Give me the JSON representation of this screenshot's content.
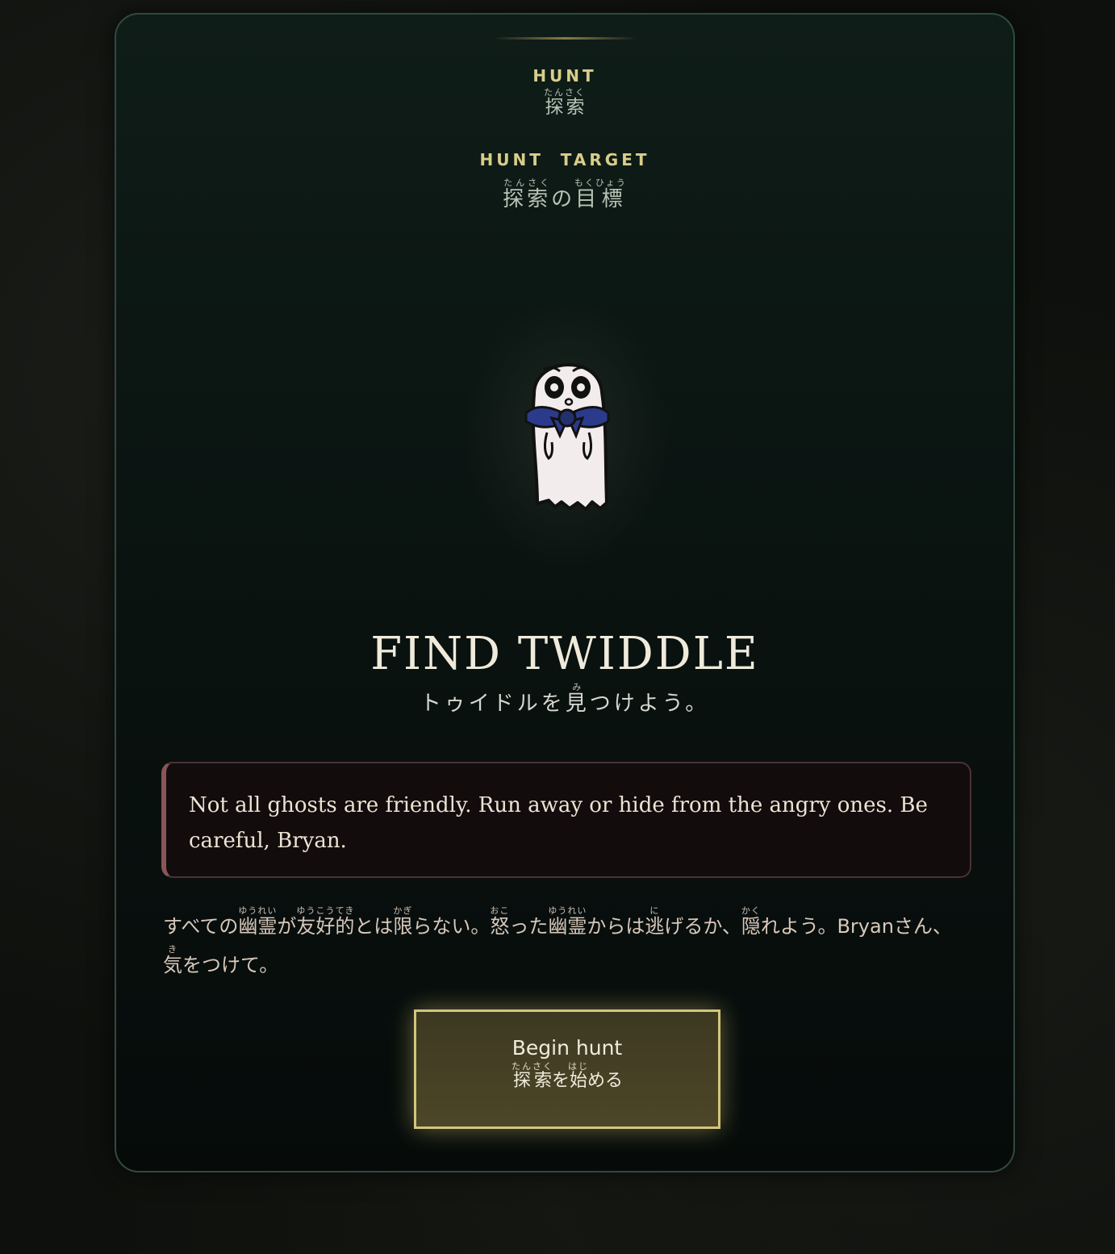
{
  "section": {
    "label_en": "HUNT",
    "label_ja_base": "探索",
    "label_ja_ruby": "たんさく"
  },
  "target": {
    "label_en": "HUNT TARGET",
    "ja_parts": [
      {
        "base": "探索",
        "ruby": "たんさく"
      },
      {
        "base": "の",
        "ruby": ""
      },
      {
        "base": "目標",
        "ruby": "もくひょう"
      }
    ]
  },
  "ghost": {
    "icon": "ghost-with-blue-bow-icon",
    "colors": {
      "body": "#f3ecec",
      "bow": "#2c3a8c",
      "outline": "#111111"
    }
  },
  "mission": {
    "title": "FIND TWIDDLE",
    "subtitle_pre": "トゥイドルを",
    "subtitle_kanji": "見",
    "subtitle_kanji_ruby": "み",
    "subtitle_post": "つけよう。"
  },
  "warning": {
    "text": "Not all ghosts are friendly. Run away or hide from the angry ones. Be careful, Bryan."
  },
  "warning_ja": {
    "s1": "すべての",
    "k1": "幽霊",
    "r1": "ゆうれい",
    "s2": "が",
    "k2": "友好的",
    "r2": "ゆうこうてき",
    "s3": "とは",
    "k3": "限",
    "r3": "かぎ",
    "s4": "らない。",
    "k4": "怒",
    "r4": "おこ",
    "s5": "った",
    "k5": "幽霊",
    "r5": "ゆうれい",
    "s6": "からは",
    "k6": "逃",
    "r6": "に",
    "s7": "げるか、",
    "k7": "隠",
    "r7": "かく",
    "s8": "れよう。Bryanさん、",
    "k8": "気",
    "r8": "き",
    "s9": "をつけて。"
  },
  "begin_button": {
    "label_en": "Begin hunt",
    "k1": "探索",
    "r1": "たんさく",
    "s1": "を",
    "k2": "始",
    "r2": "はじ",
    "s2": "める"
  },
  "colors": {
    "accent_gold": "#d8cd8a",
    "card_border": "#2f4a3f",
    "warning_border": "#8a5559"
  }
}
